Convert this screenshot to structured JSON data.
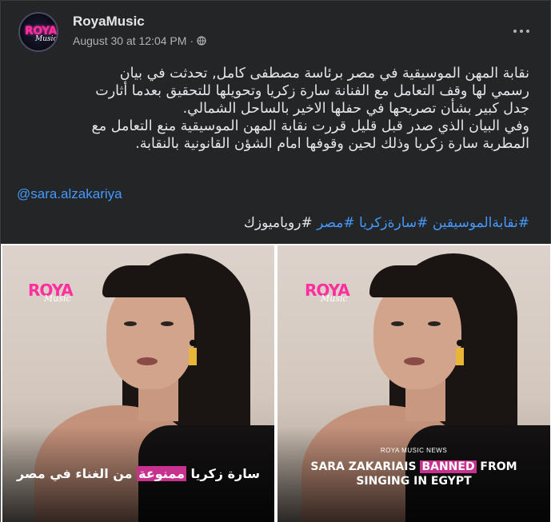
{
  "post": {
    "page_name": "RoyaMusic",
    "timestamp": "August 30 at 12:04 PM",
    "separator": "·",
    "privacy_icon": "globe-icon",
    "menu_icon": "more-dots-icon",
    "avatar": {
      "logo_top": "ROYA",
      "logo_bottom": "Music"
    },
    "text_lines": [
      "نقابة المهن الموسيقية في مصر برئاسة مصطفى كامل, تحدثت في بيان",
      "رسمي لها وقف التعامل مع الفنانة سارة زكريا وتحويلها للتحقيق بعدما أثارت",
      "جدل كبير بشأن تصريحها في حفلها الاخير بالساحل الشمالي.",
      "وفي البيان الذي صدر قبل قليل قررت نقابة المهن الموسيقية منع التعامل مع",
      "المطربة سارة زكريا وذلك لحين وقوفها امام الشؤن القانونية بالنقابة."
    ],
    "mention": "@sara.alzakariya",
    "hashtags": [
      "#نقابةالموسيقين",
      "#سارةزكريا",
      "#مصر",
      "#روياميوزك"
    ]
  },
  "images": {
    "left": {
      "logo_top": "ROYA",
      "logo_bottom": "Music",
      "caption_before": "سارة زكريا ",
      "caption_highlight": "ممنوعة",
      "caption_after": " من الغناء في مصر"
    },
    "right": {
      "logo_top": "ROYA",
      "logo_bottom": "Music",
      "news_label": "ROYA MUSIC NEWS",
      "caption_line1_before": "SARA ZAKARIAIS ",
      "caption_line1_highlight": "BANNED",
      "caption_line1_after": " FROM",
      "caption_line2": "SINGING IN EGYPT"
    }
  },
  "colors": {
    "background": "#242526",
    "text": "#e4e6eb",
    "secondary_text": "#b0b3b8",
    "link": "#4599ff",
    "brand_pink": "#ff2fa0",
    "highlight": "#c8328f"
  }
}
